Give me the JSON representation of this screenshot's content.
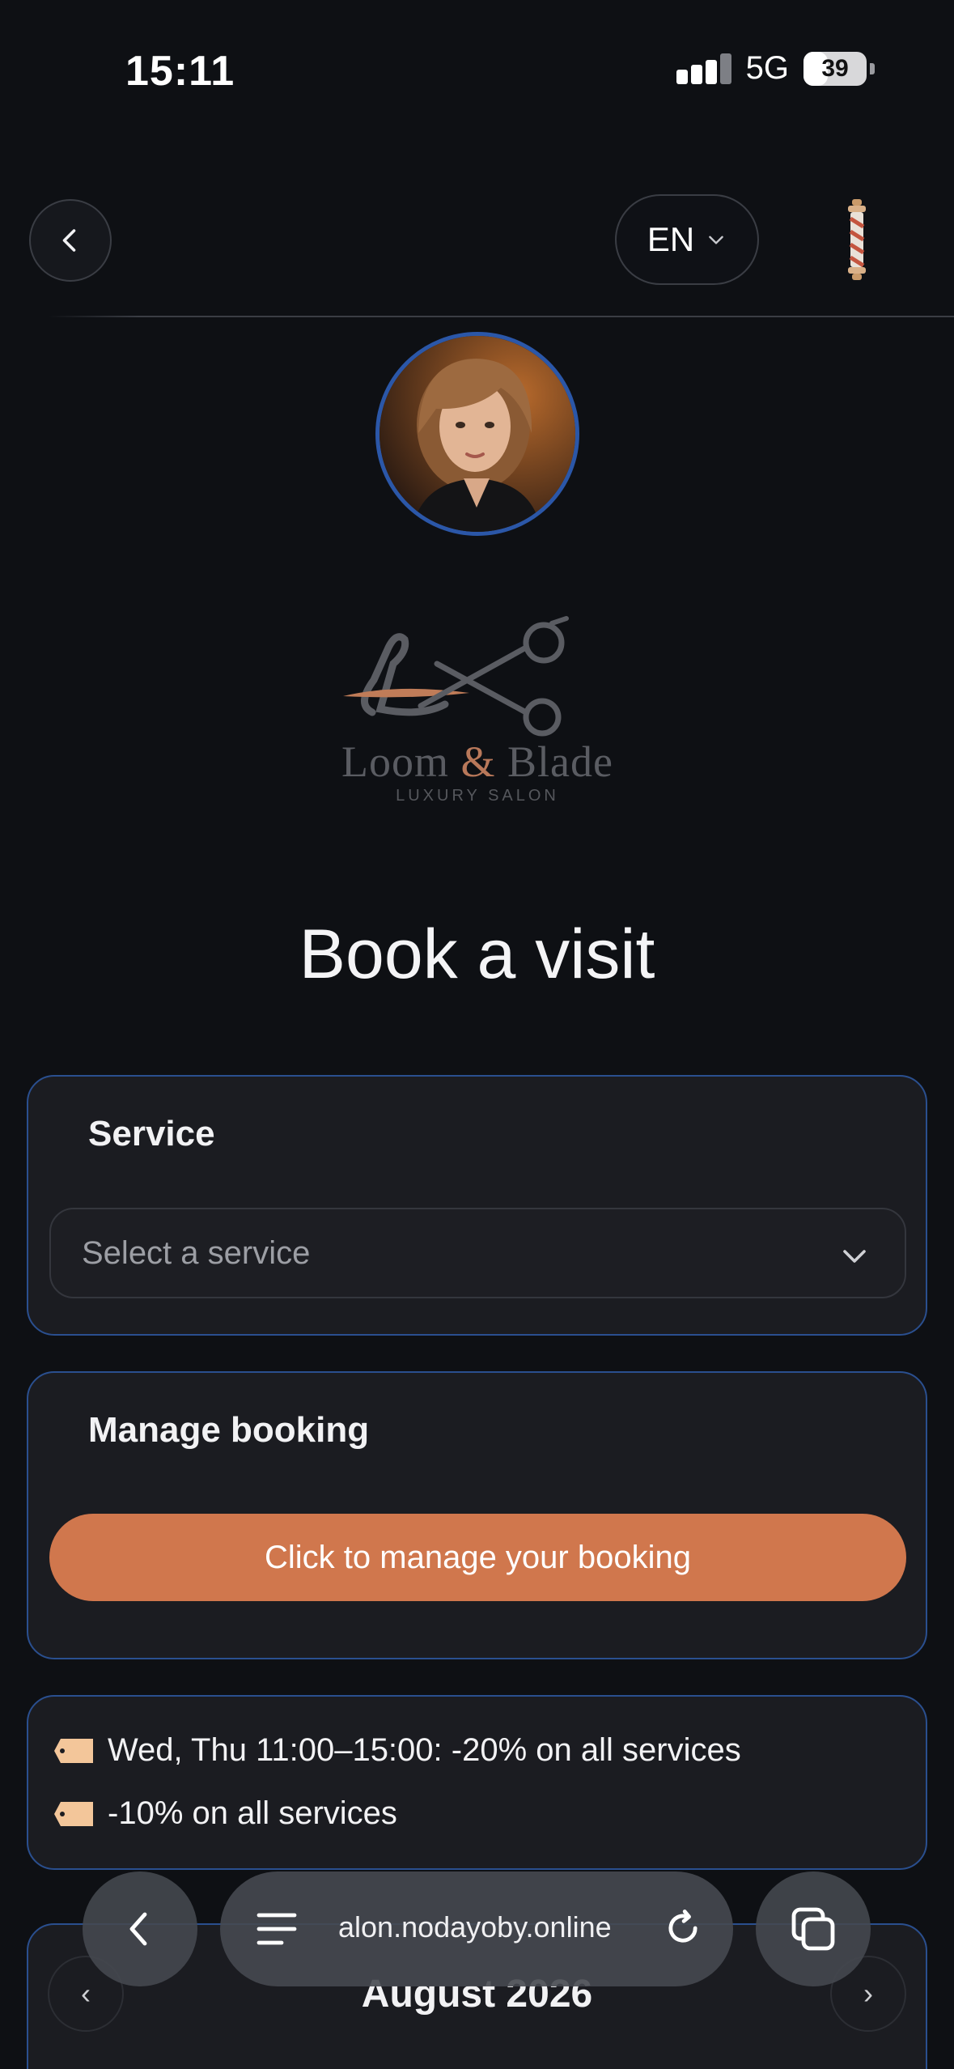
{
  "status_bar": {
    "time": "15:11",
    "network": "5G",
    "battery": "39",
    "battery_level": 0.39
  },
  "header": {
    "language": "EN"
  },
  "brand": {
    "name_part1": "Loom",
    "name_amp": "&",
    "name_part2": "Blade",
    "subtitle": "LUXURY SALON"
  },
  "page": {
    "title": "Book a visit"
  },
  "service_card": {
    "title": "Service",
    "select_placeholder": "Select a service"
  },
  "manage_card": {
    "title": "Manage booking",
    "button_label": "Click to manage your booking"
  },
  "promotions": [
    {
      "text": "Wed, Thu 11:00–15:00: -20% on all services"
    },
    {
      "text": "-10% on all services"
    }
  ],
  "calendar": {
    "month": "August 2026",
    "prev": "‹",
    "next": "›"
  },
  "browser": {
    "url": "alon.nodayoby.online"
  },
  "colors": {
    "accent": "#d0774d",
    "card_border": "#2a4f8f",
    "background": "#0e1014",
    "tag": "#f3c69a"
  }
}
